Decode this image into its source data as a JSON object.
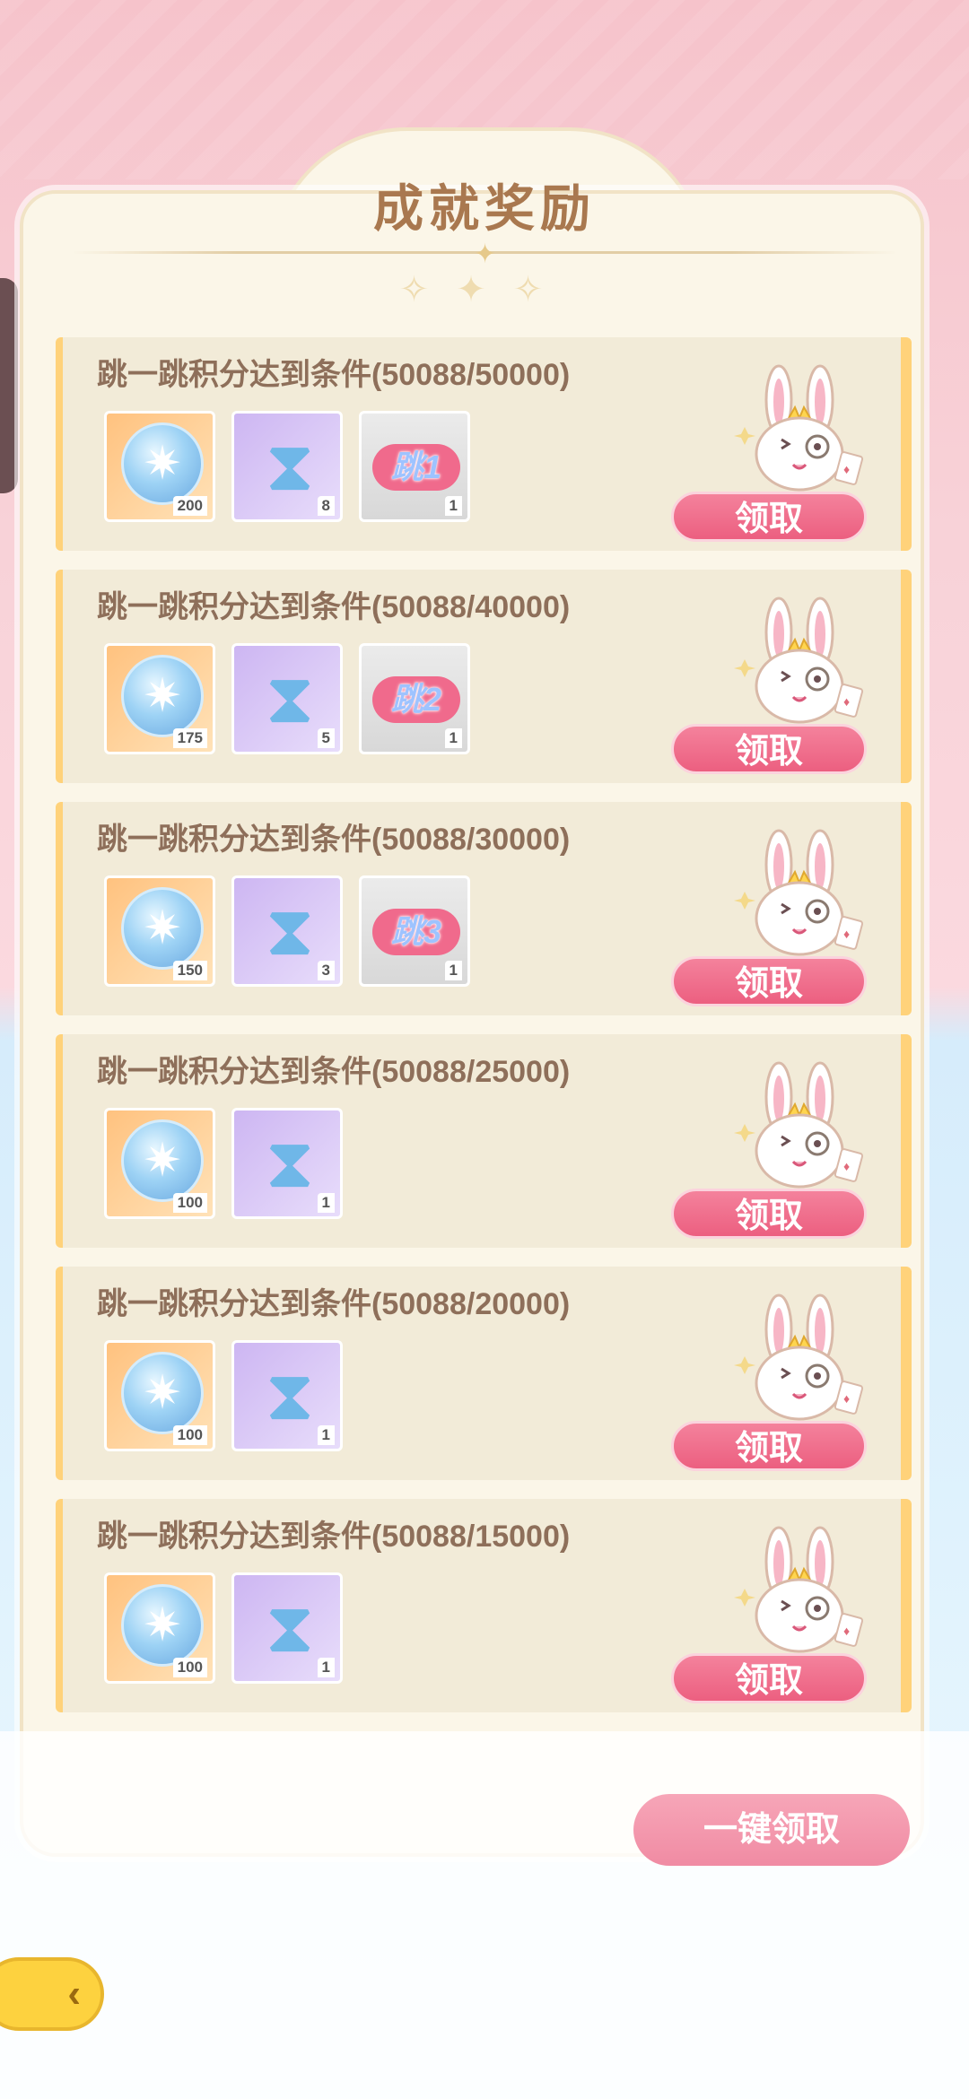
{
  "header": {
    "title": "成就奖励"
  },
  "achievements": [
    {
      "title": "跳一跳积分达到条件(50088/50000)",
      "rewards": [
        {
          "type": "coin",
          "icon": "compass-coin-icon",
          "count": "200"
        },
        {
          "type": "hourglass",
          "icon": "hourglass-icon",
          "count": "8"
        },
        {
          "type": "tag",
          "icon": "jump-tag-icon",
          "label": "跳1",
          "count": "1"
        }
      ],
      "claim_label": "领取"
    },
    {
      "title": "跳一跳积分达到条件(50088/40000)",
      "rewards": [
        {
          "type": "coin",
          "icon": "compass-coin-icon",
          "count": "175"
        },
        {
          "type": "hourglass",
          "icon": "hourglass-icon",
          "count": "5"
        },
        {
          "type": "tag",
          "icon": "jump-tag-icon",
          "label": "跳2",
          "count": "1"
        }
      ],
      "claim_label": "领取"
    },
    {
      "title": "跳一跳积分达到条件(50088/30000)",
      "rewards": [
        {
          "type": "coin",
          "icon": "compass-coin-icon",
          "count": "150"
        },
        {
          "type": "hourglass",
          "icon": "hourglass-icon",
          "count": "3"
        },
        {
          "type": "tag",
          "icon": "jump-tag-icon",
          "label": "跳3",
          "count": "1"
        }
      ],
      "claim_label": "领取"
    },
    {
      "title": "跳一跳积分达到条件(50088/25000)",
      "rewards": [
        {
          "type": "coin",
          "icon": "compass-coin-icon",
          "count": "100"
        },
        {
          "type": "hourglass",
          "icon": "hourglass-icon",
          "count": "1"
        }
      ],
      "claim_label": "领取"
    },
    {
      "title": "跳一跳积分达到条件(50088/20000)",
      "rewards": [
        {
          "type": "coin",
          "icon": "compass-coin-icon",
          "count": "100"
        },
        {
          "type": "hourglass",
          "icon": "hourglass-icon",
          "count": "1"
        }
      ],
      "claim_label": "领取"
    },
    {
      "title": "跳一跳积分达到条件(50088/15000)",
      "rewards": [
        {
          "type": "coin",
          "icon": "compass-coin-icon",
          "count": "100"
        },
        {
          "type": "hourglass",
          "icon": "hourglass-icon",
          "count": "1"
        }
      ],
      "claim_label": "领取"
    }
  ],
  "footer": {
    "claim_all_label": "一键领取",
    "back_icon": "back-arrow-icon"
  },
  "colors": {
    "claim_button": "#ec5f80",
    "claim_all_button": "#f08ba3",
    "title_text": "#a9784f",
    "row_accent": "#ffd27a",
    "back_button": "#fdd23f"
  }
}
